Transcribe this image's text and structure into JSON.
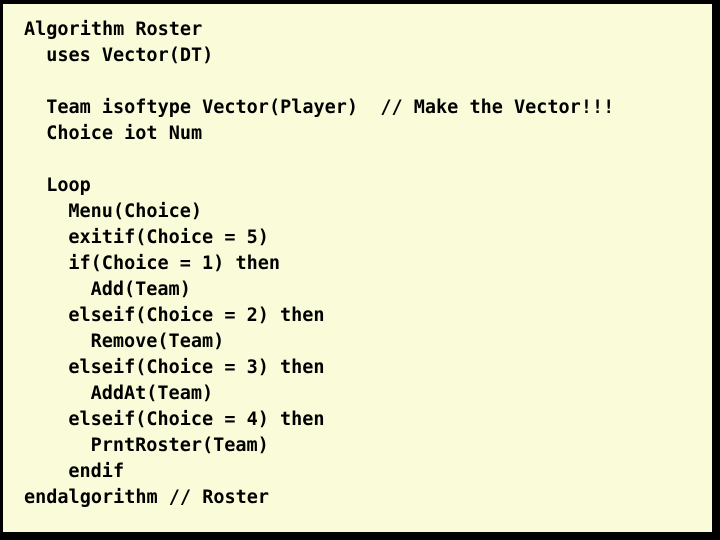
{
  "slide": {
    "title": "Algorithm Roster",
    "background_color": "#fafcd9",
    "border_color": "#000000",
    "text_color": "#000000"
  },
  "code": {
    "language": "pseudocode",
    "lines": [
      {
        "indent": 0,
        "text": "Algorithm Roster",
        "comment": ""
      },
      {
        "indent": 2,
        "text": "uses Vector(DT)",
        "comment": ""
      },
      {
        "indent": 0,
        "text": "",
        "comment": ""
      },
      {
        "indent": 2,
        "text": "Team isoftype Vector(Player)",
        "comment": "  // Make the Vector!!!"
      },
      {
        "indent": 2,
        "text": "Choice iot Num",
        "comment": ""
      },
      {
        "indent": 0,
        "text": "",
        "comment": ""
      },
      {
        "indent": 2,
        "text": "Loop",
        "comment": ""
      },
      {
        "indent": 4,
        "text": "Menu(Choice)",
        "comment": ""
      },
      {
        "indent": 4,
        "text": "exitif(Choice = 5)",
        "comment": ""
      },
      {
        "indent": 4,
        "text": "if(Choice = 1) then",
        "comment": ""
      },
      {
        "indent": 6,
        "text": "Add(Team)",
        "comment": ""
      },
      {
        "indent": 4,
        "text": "elseif(Choice = 2) then",
        "comment": ""
      },
      {
        "indent": 6,
        "text": "Remove(Team)",
        "comment": ""
      },
      {
        "indent": 4,
        "text": "elseif(Choice = 3) then",
        "comment": ""
      },
      {
        "indent": 6,
        "text": "AddAt(Team)",
        "comment": ""
      },
      {
        "indent": 4,
        "text": "elseif(Choice = 4) then",
        "comment": ""
      },
      {
        "indent": 6,
        "text": "PrntRoster(Team)",
        "comment": ""
      },
      {
        "indent": 4,
        "text": "endif",
        "comment": ""
      },
      {
        "indent": 0,
        "text": "endalgorithm // Roster",
        "comment": ""
      }
    ]
  }
}
